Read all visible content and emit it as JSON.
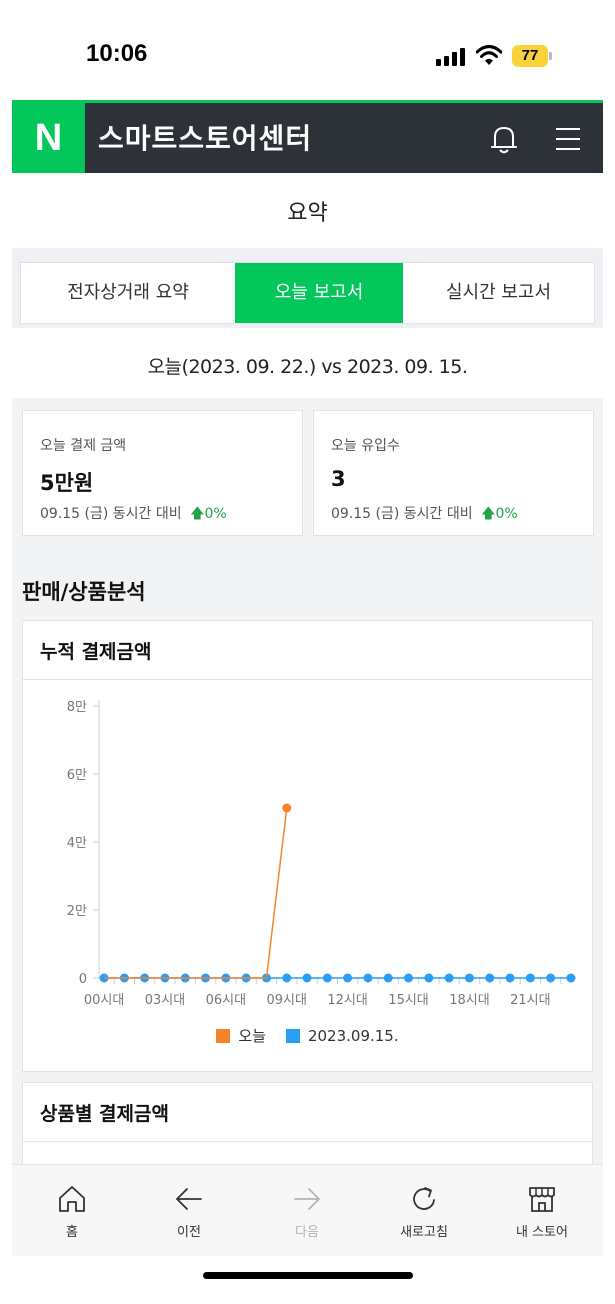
{
  "status": {
    "time": "10:06",
    "battery": "77"
  },
  "header": {
    "logo": "N",
    "title": "스마트스토어센터"
  },
  "page": {
    "title": "요약"
  },
  "tabs": [
    {
      "label": "전자상거래 요약"
    },
    {
      "label": "오늘 보고서"
    },
    {
      "label": "실시간 보고서"
    }
  ],
  "compare_title": "오늘(2023. 09. 22.) vs 2023. 09. 15.",
  "summary_cards": [
    {
      "label": "오늘 결제 금액",
      "value": "5만원",
      "sub": "09.15 (금) 동시간 대비",
      "change": "0%"
    },
    {
      "label": "오늘 유입수",
      "value": "3",
      "sub": "09.15 (금) 동시간 대비",
      "change": "0%"
    }
  ],
  "section": {
    "title": "판매/상품분석"
  },
  "chart_card": {
    "title": "누적 결제금액"
  },
  "product_card": {
    "title": "상품별 결제금액"
  },
  "colors": {
    "today": "#f5832a",
    "compare": "#2a9df4",
    "brand_green": "#03c75a",
    "up": "#22a447"
  },
  "chart_data": {
    "type": "line",
    "x": [
      "00시대",
      "01시대",
      "02시대",
      "03시대",
      "04시대",
      "05시대",
      "06시대",
      "07시대",
      "08시대",
      "09시대",
      "10시대",
      "11시대",
      "12시대",
      "13시대",
      "14시대",
      "15시대",
      "16시대",
      "17시대",
      "18시대",
      "19시대",
      "20시대",
      "21시대",
      "22시대",
      "23시대"
    ],
    "xtick_labels": [
      "00시대",
      "03시대",
      "06시대",
      "09시대",
      "12시대",
      "15시대",
      "18시대",
      "21시대"
    ],
    "series": [
      {
        "name": "오늘",
        "values": [
          0,
          0,
          0,
          0,
          0,
          0,
          0,
          0,
          0,
          50000
        ]
      },
      {
        "name": "2023.09.15.",
        "values": [
          0,
          0,
          0,
          0,
          0,
          0,
          0,
          0,
          0,
          0,
          0,
          0,
          0,
          0,
          0,
          0,
          0,
          0,
          0,
          0,
          0,
          0,
          0,
          0
        ]
      }
    ],
    "ytick_labels": [
      "0",
      "2만",
      "4만",
      "6만",
      "8만"
    ],
    "ylim": [
      0,
      80000
    ],
    "legend": "bottom",
    "grid": false
  },
  "nav": [
    {
      "label": "홈",
      "icon": "home-icon"
    },
    {
      "label": "이전",
      "icon": "arrow-left-icon"
    },
    {
      "label": "다음",
      "icon": "arrow-right-icon"
    },
    {
      "label": "새로고침",
      "icon": "refresh-icon"
    },
    {
      "label": "내 스토어",
      "icon": "store-icon"
    }
  ]
}
